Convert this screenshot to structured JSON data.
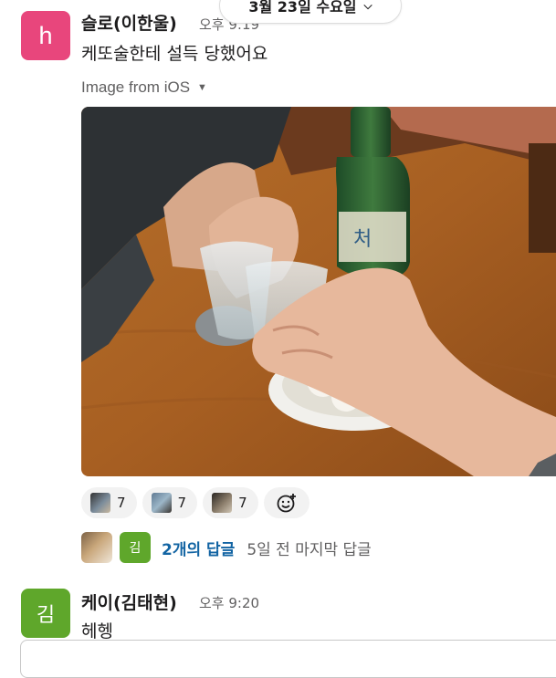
{
  "date_divider": {
    "label": "3월 23일 수요일"
  },
  "messages": [
    {
      "avatar_letter": "h",
      "author": "슬로(이한울)",
      "time": "오후 9:19",
      "text": "케또술한테 설득 당했어요",
      "attachment": {
        "label": "Image from iOS"
      },
      "reactions": [
        {
          "icon": "user-avatar-emoji",
          "count": "7"
        },
        {
          "icon": "user-avatar-emoji",
          "count": "7"
        },
        {
          "icon": "user-avatar-emoji",
          "count": "7"
        }
      ],
      "add_reaction_icon": "add-emoji-icon",
      "thread": {
        "participant_initial": "김",
        "reply_count": "2개의 답글",
        "last_reply": "5일 전 마지막 답글"
      }
    },
    {
      "avatar_letter": "김",
      "author": "케이(김태현)",
      "time": "오후 9:20",
      "text": "헤헹"
    }
  ],
  "colors": {
    "avatar_h": "#e8467c",
    "avatar_kim": "#5fa72b",
    "link": "#1264a3"
  }
}
